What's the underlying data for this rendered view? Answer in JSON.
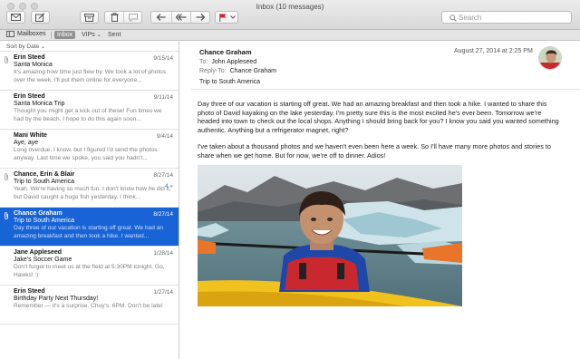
{
  "window": {
    "title": "Inbox (10 messages)"
  },
  "toolbar": {
    "search_placeholder": "Search"
  },
  "favorites": {
    "mailboxes": "Mailboxes",
    "inbox": "Inbox",
    "vips": "VIPs",
    "sent": "Sent"
  },
  "list": {
    "sort_label": "Sort by Date",
    "messages": [
      {
        "sender": "Erin Steed",
        "date": "9/15/14",
        "subject": "Santa Monica",
        "preview": "It's amazing how time just flew by. We took a lot of photos over the week, I'll put them online for everyone...",
        "attachment": true
      },
      {
        "sender": "Erin Steed",
        "date": "9/11/14",
        "subject": "Santa Monica Trip",
        "preview": "Thought you might get a kick out of these! Fun times we had by the beach. I hope to do this again soon...",
        "attachment": false
      },
      {
        "sender": "Mani White",
        "date": "9/4/14",
        "subject": "Aye, aye",
        "preview": "Long overdue, I know. but I figured I'd send the photos anyway. Last time we spoke, you said you hadn't...",
        "attachment": false
      },
      {
        "sender": "Chance, Erin & Blair",
        "date": "8/27/14",
        "subject": "Trip to South America",
        "thread_count": "4 »",
        "preview": "Yeah. We're having so much fun. I don't know how he did it, but David caught a huge fish yesterday. I think...",
        "attachment": true
      },
      {
        "sender": "Chance Graham",
        "date": "8/27/14",
        "subject": "Trip to South America",
        "preview": "Day three of our vacation is starting off great. We had an amazing breakfast and then took a hike. I wanted...",
        "attachment": true,
        "selected": true
      },
      {
        "sender": "Jane Appleseed",
        "date": "1/28/14",
        "subject": "Jake's Soccer Game",
        "preview": "Don't forget to meet us at the field at 5:30PM tonight. Go, Hawks! :)",
        "attachment": false
      },
      {
        "sender": "Erin Steed",
        "date": "1/27/14",
        "subject": "Birthday Party Next Thursday!",
        "preview": "Remember — it's a surprise. Chuy's. 6PM. Don't be late!",
        "attachment": false
      }
    ]
  },
  "message": {
    "from": "Chance Graham",
    "date": "August 27, 2014 at 2:25 PM",
    "to_label": "To:",
    "to": "John Appleseed",
    "reply_to_label": "Reply-To:",
    "reply_to": "Chance Graham",
    "subject": "Trip to South America",
    "body_p1": "Day three of our vacation is starting off great. We had an amazing breakfast and then took a hike. I wanted to share this photo of David kayaking on the lake yesterday. I'm pretty sure this is the most excited he's ever been. Tomorrow we're headed into town to check out the local shops. Anything I should bring back for you? I know you said you wanted something authentic. Anything but a refrigerator magnet, right?",
    "body_p2": "I've taken about a thousand photos and we haven't even been here a week. So I'll have many more photos and stories to share when we get home. But for now, we're off to dinner. Adios!"
  },
  "colors": {
    "selection": "#1863d6",
    "flag": "#e0192d",
    "link": "#2d77d0"
  }
}
